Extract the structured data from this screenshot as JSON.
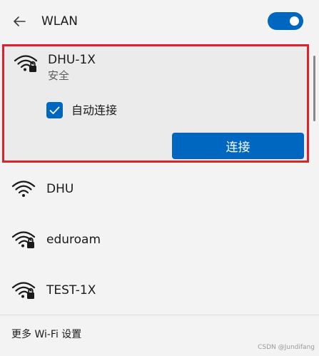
{
  "header": {
    "title": "WLAN",
    "toggle_on": true,
    "accent": "#0067c0"
  },
  "expanded_network": {
    "name": "DHU-1X",
    "status": "安全",
    "secured": true,
    "auto_connect_label": "自动连接",
    "auto_connect_checked": true,
    "connect_label": "连接",
    "highlight_color": "#e0202a"
  },
  "networks": [
    {
      "name": "DHU",
      "secured": false
    },
    {
      "name": "eduroam",
      "secured": true
    },
    {
      "name": "TEST-1X",
      "secured": true
    }
  ],
  "footer": {
    "link_label": "更多 Wi-Fi 设置"
  },
  "watermark": "CSDN @Jundifang"
}
